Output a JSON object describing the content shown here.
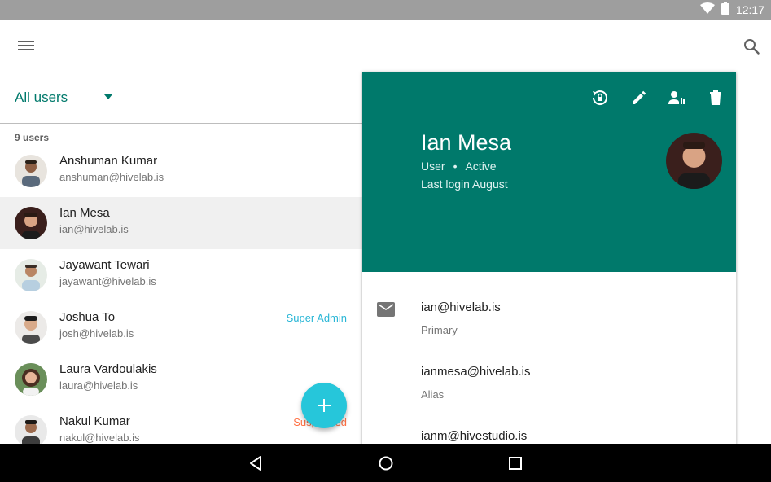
{
  "status_bar": {
    "time": "12:17",
    "icons": [
      "wifi-icon",
      "battery-icon"
    ]
  },
  "app_bar": {
    "icons": [
      "menu-icon",
      "search-icon"
    ]
  },
  "filter": {
    "label": "All users"
  },
  "list": {
    "count_label": "9 users",
    "users": [
      {
        "name": "Anshuman Kumar",
        "email": "anshuman@hivelab.is",
        "badge": ""
      },
      {
        "name": "Ian Mesa",
        "email": "ian@hivelab.is",
        "badge": ""
      },
      {
        "name": "Jayawant Tewari",
        "email": "jayawant@hivelab.is",
        "badge": ""
      },
      {
        "name": "Joshua To",
        "email": "josh@hivelab.is",
        "badge": "Super Admin"
      },
      {
        "name": "Laura Vardoulakis",
        "email": "laura@hivelab.is",
        "badge": ""
      },
      {
        "name": "Nakul Kumar",
        "email": "nakul@hivelab.is",
        "badge": "Suspended"
      }
    ]
  },
  "detail": {
    "name": "Ian Mesa",
    "role": "User",
    "separator": "•",
    "status": "Active",
    "last_login": "Last login August",
    "actions": [
      "reset-password-icon",
      "edit-icon",
      "manage-roles-icon",
      "delete-icon"
    ],
    "emails": [
      {
        "address": "ian@hivelab.is",
        "type": "Primary"
      },
      {
        "address": "ianmesa@hivelab.is",
        "type": "Alias"
      },
      {
        "address": "ianm@hivestudio.is",
        "type": ""
      }
    ]
  },
  "colors": {
    "primary": "#00796b",
    "accent": "#26c6da",
    "super_admin": "#29b6d6",
    "suspended": "#ff7043"
  },
  "nav_bar": {
    "icons": [
      "back-icon",
      "home-icon",
      "recents-icon"
    ]
  }
}
